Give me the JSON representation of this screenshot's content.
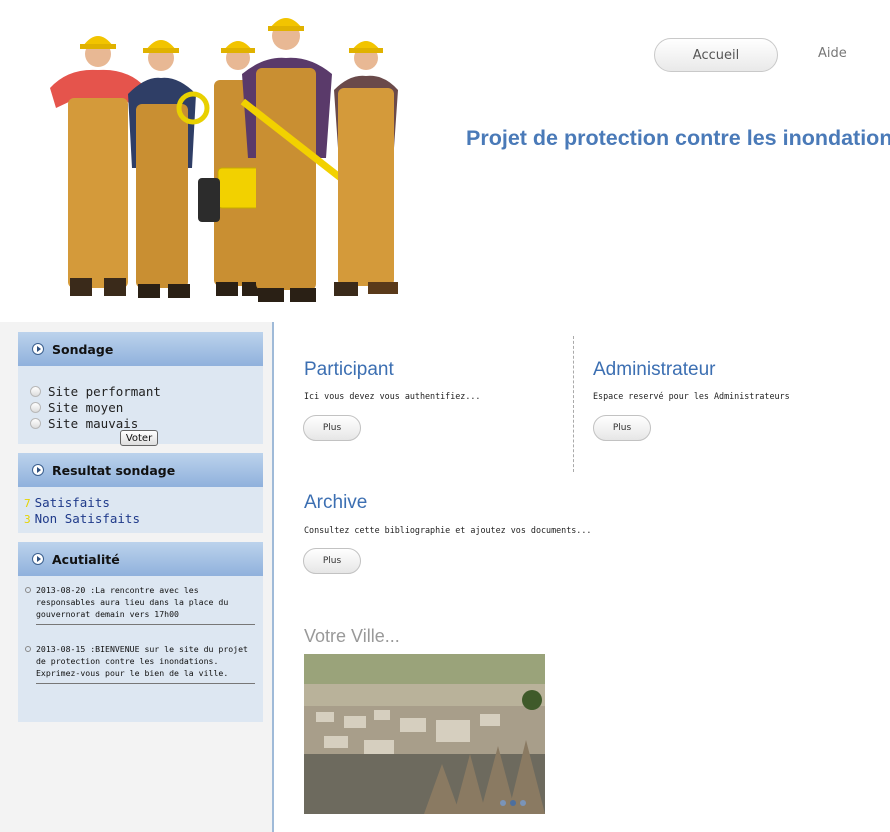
{
  "header": {
    "nav_home": "Accueil",
    "nav_help": "Aide",
    "site_title": "Projet de protection contre les inondations"
  },
  "sidebar": {
    "poll": {
      "title": "Sondage",
      "options": [
        "Site performant",
        "Site moyen",
        "Site mauvais"
      ],
      "vote_label": "Voter"
    },
    "results": {
      "title": "Resultat sondage",
      "rows": [
        {
          "count": "7",
          "label": "Satisfaits"
        },
        {
          "count": "3",
          "label": "Non Satisfaits"
        }
      ]
    },
    "news": {
      "title": "Acutialité",
      "items": [
        "2013-08-20 :La rencontre avec les responsables aura lieu dans la place du gouvernorat demain vers 17h00",
        "2013-08-15 :BIENVENUE sur le site du projet de protection contre les inondations. Exprimez-vous pour le bien de la ville."
      ]
    }
  },
  "main": {
    "participant": {
      "title": "Participant",
      "desc": "Ici vous devez vous authentifiez...",
      "button": "Plus"
    },
    "admin": {
      "title": "Administrateur",
      "desc": "Espace reservé pour les Administrateurs",
      "button": "Plus"
    },
    "archive": {
      "title": "Archive",
      "desc": "Consultez cette bibliographie et ajoutez vos documents...",
      "button": "Plus"
    },
    "city": {
      "title": "Votre Ville..."
    }
  },
  "colors": {
    "accent_blue": "#4a7ab8",
    "sidebar_header": "#8fb1dc",
    "sidebar_bg": "#dde7f2",
    "result_count": "#e5d400"
  }
}
